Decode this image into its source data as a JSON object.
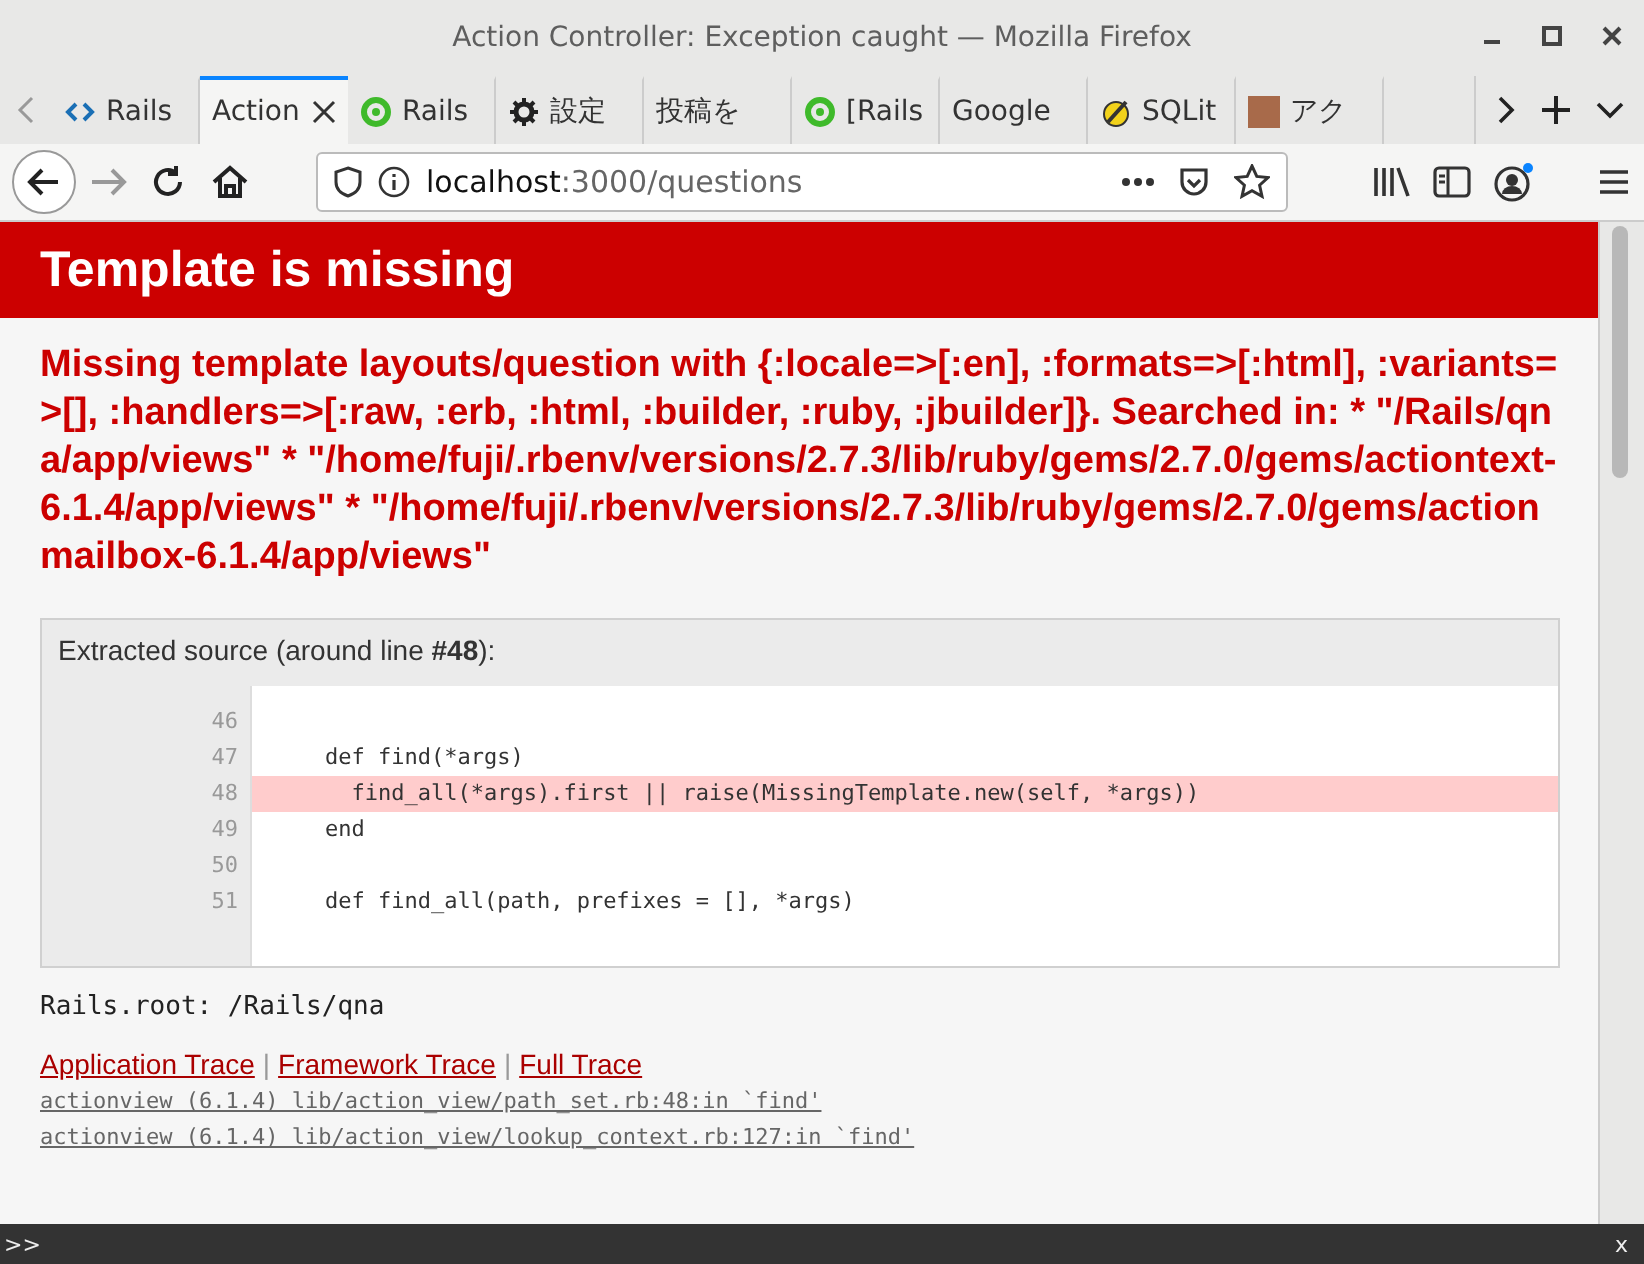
{
  "window": {
    "title": "Action Controller: Exception caught — Mozilla Firefox"
  },
  "tabs": [
    {
      "label": "Rails",
      "kind": "code",
      "selected": false
    },
    {
      "label": "Action",
      "kind": "plain",
      "selected": true
    },
    {
      "label": "Rails",
      "kind": "ring",
      "selected": false
    },
    {
      "label": "設定",
      "kind": "gear",
      "selected": false
    },
    {
      "label": "投稿を",
      "kind": "plain",
      "selected": false
    },
    {
      "label": "[Rails",
      "kind": "ring",
      "selected": false
    },
    {
      "label": "Google",
      "kind": "plain",
      "selected": false
    },
    {
      "label": "SQLit",
      "kind": "feather",
      "selected": false
    },
    {
      "label": "アク",
      "kind": "photo",
      "selected": false
    }
  ],
  "address": {
    "host": "localhost",
    "rest": ":3000/questions"
  },
  "page": {
    "header": "Template is missing",
    "message": "Missing template layouts/question with {:locale=>[:en], :formats=>[:html], :variants=>[], :handlers=>[:raw, :erb, :html, :builder, :ruby, :jbuilder]}. Searched in: * \"/Rails/qna/app/views\" * \"/home/fuji/.rbenv/versions/2.7.3/lib/ruby/gems/2.7.0/gems/actiontext-6.1.4/app/views\" * \"/home/fuji/.rbenv/versions/2.7.3/lib/ruby/gems/2.7.0/gems/actionmailbox-6.1.4/app/views\"",
    "source_title": "Extracted source (around line **#48**):",
    "source_lines": [
      {
        "number": "46",
        "selected": false
      },
      {
        "number": "47",
        "code": "    def find(*args)",
        "selected": false
      },
      {
        "number": "48",
        "code": "      find_all(*args).first || raise(MissingTemplate.new(self, *args))",
        "selected": true
      },
      {
        "number": "49",
        "code": "    end",
        "selected": false
      },
      {
        "number": "50",
        "selected": false
      },
      {
        "number": "51",
        "code": "    def find_all(path, prefixes = [], *args)",
        "selected": false
      }
    ],
    "rails_root": "Rails.root: /Rails/qna",
    "trace_links": [
      "Application Trace",
      "Framework Trace",
      "Full Trace"
    ],
    "trace_separator": "|",
    "trace_lines": [
      "actionview (6.1.4) lib/action_view/path_set.rb:48:in `find'",
      "actionview (6.1.4) lib/action_view/lookup_context.rb:127:in `find'"
    ]
  },
  "console": {
    "prompt": ">>",
    "close": "x"
  }
}
